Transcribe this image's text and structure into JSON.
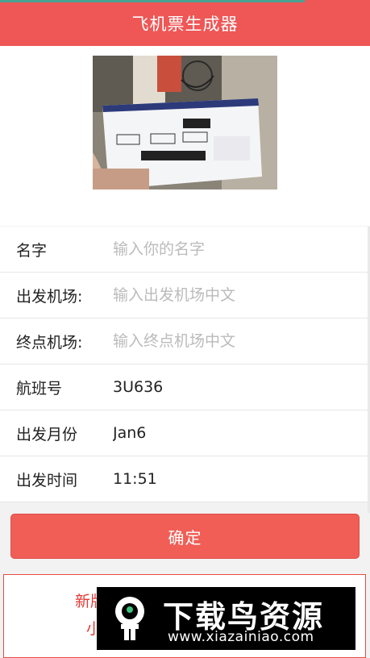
{
  "header": {
    "title": "飞机票生成器"
  },
  "photo": {
    "alt": "boarding-pass-photo"
  },
  "form": {
    "rows": [
      {
        "label": "名字",
        "value": "",
        "placeholder": "输入你的名字"
      },
      {
        "label": "出发机场:",
        "value": "",
        "placeholder": "输入出发机场中文"
      },
      {
        "label": "终点机场:",
        "value": "",
        "placeholder": "输入终点机场中文"
      },
      {
        "label": "航班号",
        "value": "3U636",
        "placeholder": ""
      },
      {
        "label": "出发月份",
        "value": "Jan6",
        "placeholder": ""
      },
      {
        "label": "出发时间",
        "value": "11:51",
        "placeholder": ""
      }
    ]
  },
  "confirm_label": "确定",
  "notice": {
    "line1": "新版",
    "line2": "小"
  },
  "watermark": {
    "main": "下载鸟资源",
    "url": "www.xiazainiao.com"
  },
  "colors": {
    "brand": "#ef5656",
    "accent_teal": "#4ba293",
    "notice_red": "#e23b36"
  }
}
